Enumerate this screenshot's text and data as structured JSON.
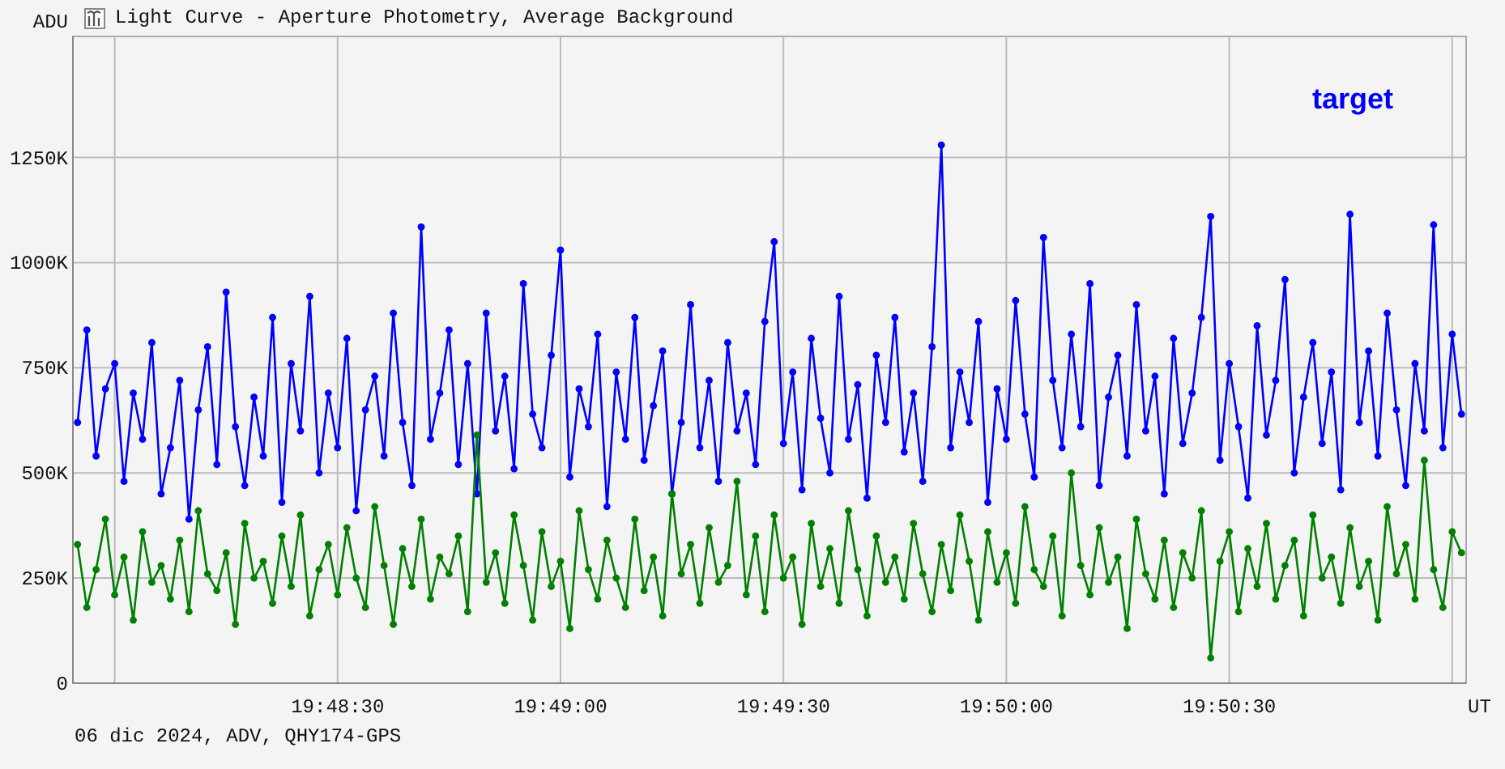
{
  "window": {
    "title": "Light Curve - Aperture Photometry, Average Background"
  },
  "chart_data": {
    "type": "line",
    "ylabel": "ADU",
    "xlabel": "UT",
    "grid": true,
    "ylim": [
      0,
      1538
    ],
    "categories": [
      null,
      null,
      null,
      null,
      null,
      null,
      null,
      null,
      null,
      null,
      null,
      null,
      null,
      null,
      null,
      null,
      null,
      null,
      null,
      null,
      null,
      null,
      null,
      null,
      null,
      null,
      null,
      null,
      "19:48:30",
      null,
      null,
      null,
      null,
      null,
      null,
      null,
      null,
      null,
      null,
      null,
      null,
      null,
      null,
      null,
      null,
      null,
      null,
      null,
      null,
      null,
      null,
      null,
      "19:49:00",
      null,
      null,
      null,
      null,
      null,
      null,
      null,
      null,
      null,
      null,
      null,
      null,
      null,
      null,
      null,
      null,
      null,
      null,
      null,
      null,
      null,
      null,
      null,
      "19:49:30",
      null,
      null,
      null,
      null,
      null,
      null,
      null,
      null,
      null,
      null,
      null,
      null,
      null,
      null,
      null,
      null,
      null,
      null,
      null,
      null,
      null,
      null,
      null,
      "19:50:00",
      null,
      null,
      null,
      null,
      null,
      null,
      null,
      null,
      null,
      null,
      null,
      null,
      null,
      null,
      null,
      null,
      null,
      null,
      null,
      null,
      null,
      null,
      null,
      "19:50:30",
      null,
      null,
      null,
      null,
      null,
      null,
      null,
      null,
      null,
      null,
      null,
      null,
      null,
      null,
      null,
      null,
      null,
      null,
      null,
      null,
      null,
      null,
      null,
      null,
      null
    ],
    "yticks": [
      {
        "value": 0,
        "label": "0"
      },
      {
        "value": 250,
        "label": "250K"
      },
      {
        "value": 500,
        "label": "500K"
      },
      {
        "value": 750,
        "label": "750K"
      },
      {
        "value": 1000,
        "label": "1000K"
      },
      {
        "value": 1250,
        "label": "1250K"
      }
    ],
    "series": [
      {
        "name": "target",
        "color": "#0000ff",
        "marker": "circle",
        "values": [
          620,
          840,
          540,
          700,
          760,
          480,
          690,
          580,
          810,
          450,
          560,
          720,
          390,
          650,
          800,
          520,
          930,
          610,
          470,
          680,
          540,
          870,
          430,
          760,
          600,
          920,
          500,
          690,
          560,
          820,
          410,
          650,
          730,
          540,
          880,
          620,
          470,
          1085,
          580,
          690,
          840,
          520,
          760,
          450,
          880,
          600,
          730,
          510,
          950,
          640,
          560,
          780,
          1030,
          490,
          700,
          610,
          830,
          420,
          740,
          580,
          870,
          530,
          660,
          790,
          450,
          620,
          900,
          560,
          720,
          480,
          810,
          600,
          690,
          520,
          860,
          1050,
          570,
          740,
          460,
          820,
          630,
          500,
          920,
          580,
          710,
          440,
          780,
          620,
          870,
          550,
          690,
          480,
          800,
          1280,
          560,
          740,
          620,
          860,
          430,
          700,
          580,
          910,
          640,
          490,
          1060,
          720,
          560,
          830,
          610,
          950,
          470,
          680,
          780,
          540,
          900,
          600,
          730,
          450,
          820,
          570,
          690,
          870,
          1110,
          530,
          760,
          610,
          440,
          850,
          590,
          720,
          960,
          500,
          680,
          810,
          570,
          740,
          460,
          1115,
          620,
          790,
          540,
          880,
          650,
          470,
          760,
          600,
          1090,
          560,
          830,
          640
        ]
      },
      {
        "color": "#008000",
        "marker": "circle",
        "values": [
          330,
          180,
          270,
          390,
          210,
          300,
          150,
          360,
          240,
          280,
          200,
          340,
          170,
          410,
          260,
          220,
          310,
          140,
          380,
          250,
          290,
          190,
          350,
          230,
          400,
          160,
          270,
          330,
          210,
          370,
          250,
          180,
          420,
          280,
          140,
          320,
          230,
          390,
          200,
          300,
          260,
          350,
          170,
          590,
          240,
          310,
          190,
          400,
          280,
          150,
          360,
          230,
          290,
          130,
          410,
          270,
          200,
          340,
          250,
          180,
          390,
          220,
          300,
          160,
          450,
          260,
          330,
          190,
          370,
          240,
          280,
          480,
          210,
          350,
          170,
          400,
          250,
          300,
          140,
          380,
          230,
          320,
          190,
          410,
          270,
          160,
          350,
          240,
          300,
          200,
          380,
          260,
          170,
          330,
          220,
          400,
          290,
          150,
          360,
          240,
          310,
          190,
          420,
          270,
          230,
          350,
          160,
          500,
          280,
          210,
          370,
          240,
          300,
          130,
          390,
          260,
          200,
          340,
          180,
          310,
          250,
          410,
          60,
          290,
          360,
          170,
          320,
          230,
          380,
          200,
          280,
          340,
          160,
          400,
          250,
          300,
          190,
          370,
          230,
          290,
          150,
          420,
          260,
          330,
          200,
          530,
          270,
          180,
          360,
          310
        ]
      }
    ]
  },
  "footer": "06 dic 2024, ADV, QHY174-GPS"
}
